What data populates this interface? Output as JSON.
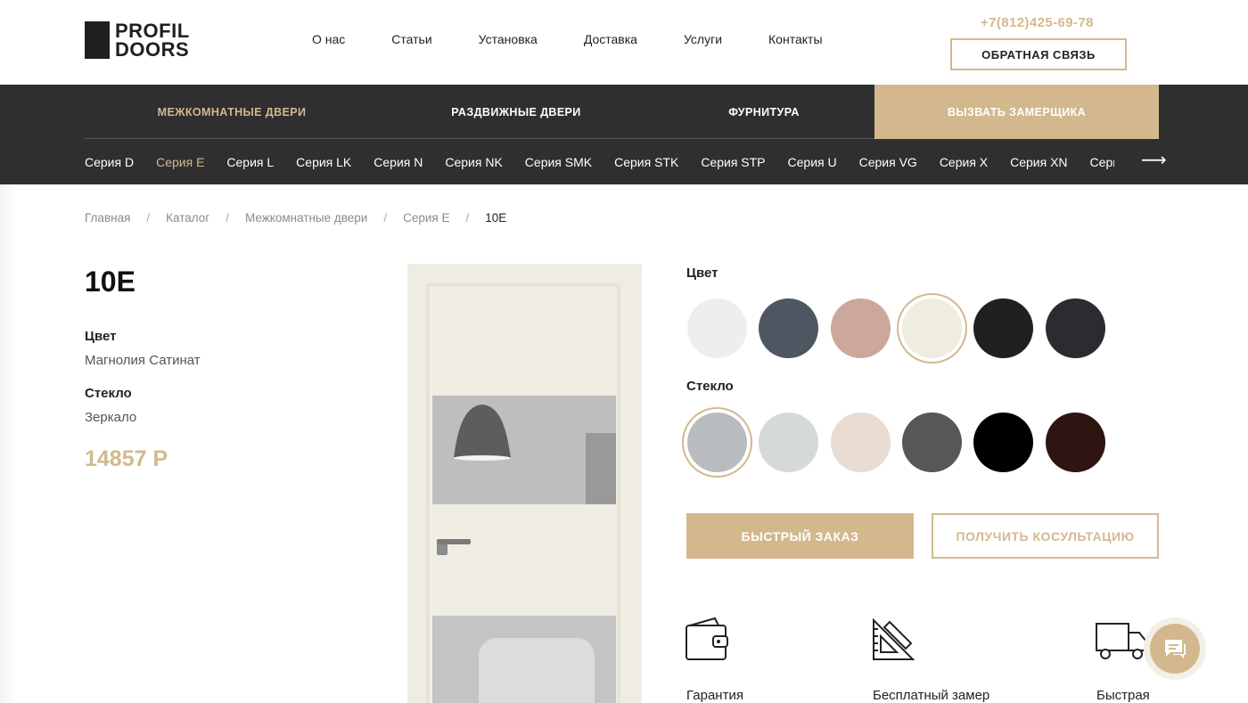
{
  "brand": {
    "line1": "PROFIL",
    "line2": "DOORS"
  },
  "nav": [
    "О нас",
    "Статьи",
    "Установка",
    "Доставка",
    "Услуги",
    "Контакты"
  ],
  "phone": "+7(812)425-69-78",
  "feedback_label": "ОБРАТНАЯ СВЯЗЬ",
  "categories": [
    "МЕЖКОМНАТНЫЕ ДВЕРИ",
    "РАЗДВИЖНЫЕ ДВЕРИ",
    "ФУРНИТУРА",
    "ВЫЗВАТЬ ЗАМЕРЩИКА"
  ],
  "series": [
    "Серия D",
    "Серия E",
    "Серия L",
    "Серия LK",
    "Серия N",
    "Серия NK",
    "Серия SMK",
    "Серия STK",
    "Серия STP",
    "Серия U",
    "Серия VG",
    "Серия X",
    "Серия XN",
    "Серия"
  ],
  "series_active": "Серия E",
  "series_arrow": "⟶",
  "breadcrumb": [
    "Главная",
    "Каталог",
    "Межкомнатные двери",
    "Серия E",
    "10E"
  ],
  "breadcrumb_sep": "/",
  "product": {
    "title": "10E",
    "color_label": "Цвет",
    "color_value": "Магнолия Сатинат",
    "glass_label": "Стекло",
    "glass_value": "Зеркало",
    "price": "14857 Р"
  },
  "options": {
    "color_label": "Цвет",
    "glass_label": "Стекло",
    "color_swatches": [
      {
        "color": "#eceef0",
        "selected": false
      },
      {
        "color": "#4e5661",
        "selected": false
      },
      {
        "color": "#cba89b",
        "selected": false
      },
      {
        "color": "#efece0",
        "selected": true
      },
      {
        "color": "#221f1f",
        "selected": false
      },
      {
        "color": "#2b2c31",
        "selected": false
      }
    ],
    "glass_swatches": [
      {
        "color": "#b9bcbf",
        "selected": true
      },
      {
        "color": "#d6dad6",
        "selected": false
      },
      {
        "color": "#e8dcd3",
        "selected": false
      },
      {
        "color": "#555759",
        "selected": false
      },
      {
        "color": "#000000",
        "selected": false
      },
      {
        "color": "#2e1512",
        "selected": false
      }
    ]
  },
  "actions": {
    "quick_order": "БЫСТРЫЙ ЗАКАЗ",
    "consult": "ПОЛУЧИТЬ КОСУЛЬТАЦИЮ"
  },
  "features": [
    {
      "icon": "wallet-icon",
      "label": "Гарантия"
    },
    {
      "icon": "ruler-triangle-icon",
      "label": "Бесплатный замер"
    },
    {
      "icon": "truck-icon",
      "label": "Быстрая"
    }
  ],
  "colors": {
    "accent": "#d3b88e",
    "dark": "#2f2f2f"
  }
}
